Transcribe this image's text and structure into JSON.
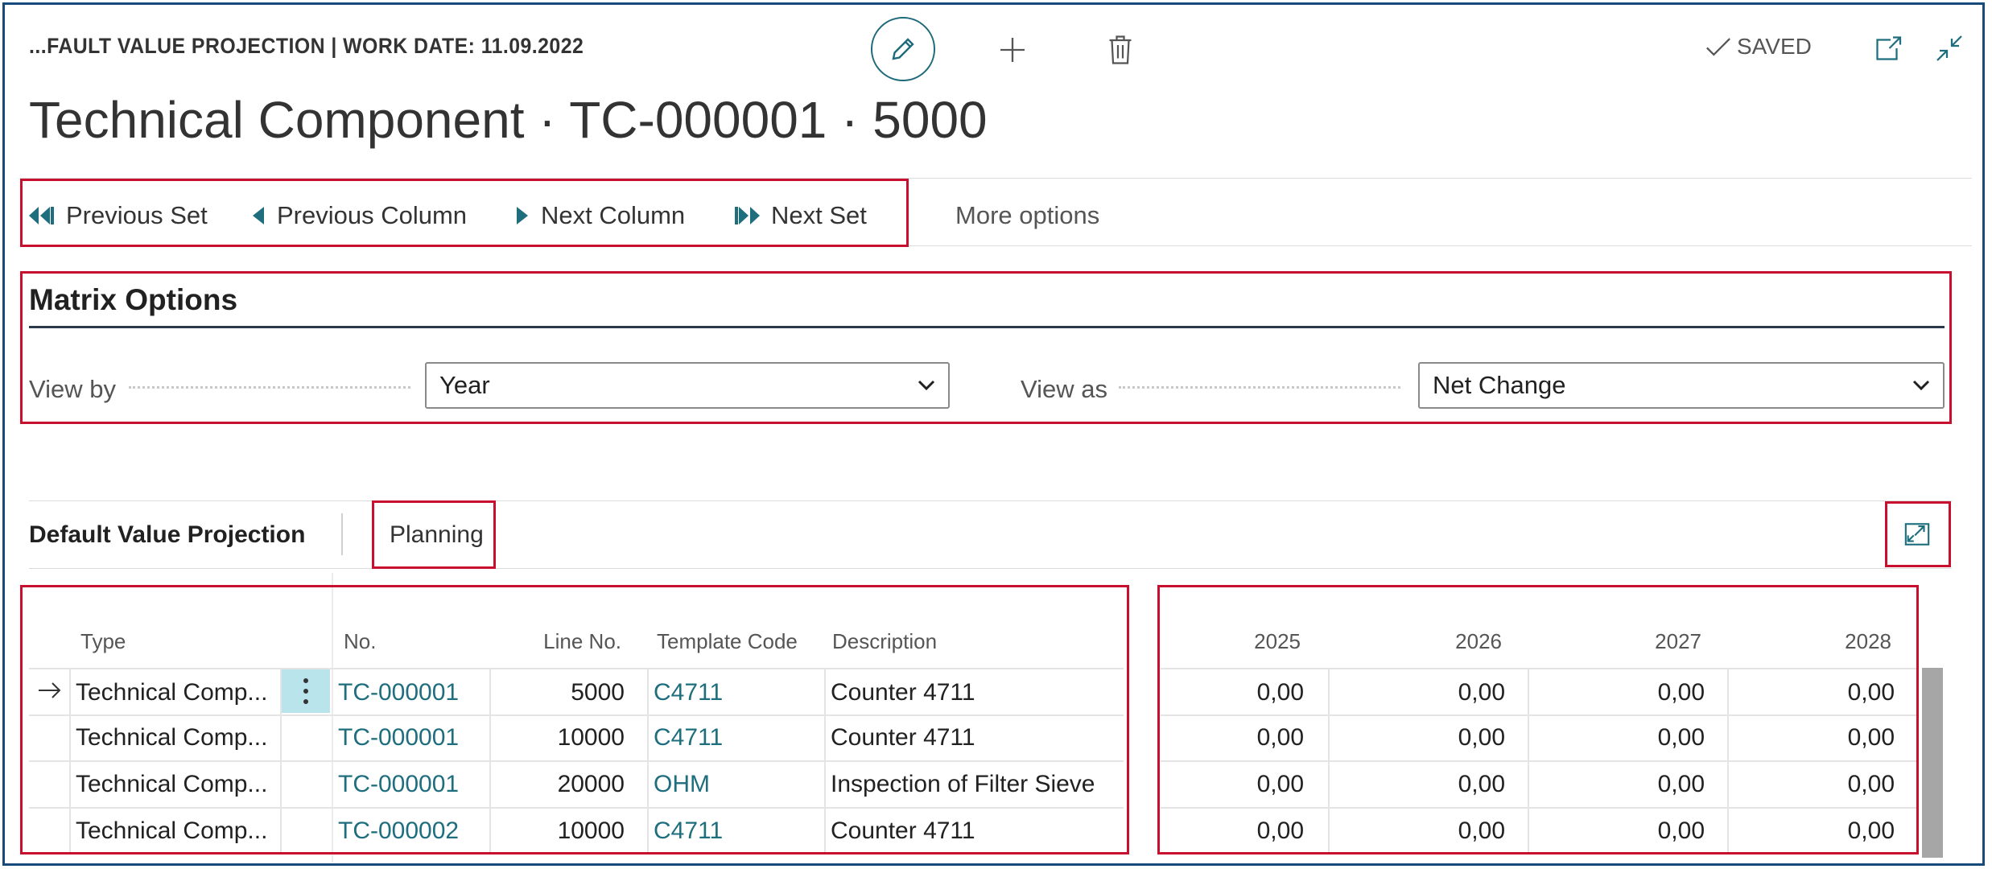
{
  "header": {
    "caption": "...FAULT VALUE PROJECTION | WORK DATE: 11.09.2022",
    "title": "Technical Component · TC-000001 · 5000",
    "saved_label": "SAVED"
  },
  "actions": {
    "previous_set": "Previous Set",
    "previous_column": "Previous Column",
    "next_column": "Next Column",
    "next_set": "Next Set",
    "more_options": "More options"
  },
  "matrix_options": {
    "title": "Matrix Options",
    "view_by_label": "View by",
    "view_by_value": "Year",
    "view_as_label": "View as",
    "view_as_value": "Net Change"
  },
  "part": {
    "title": "Default Value Projection",
    "tab": "Planning"
  },
  "table": {
    "headers": {
      "type": "Type",
      "no": "No.",
      "line_no": "Line No.",
      "template_code": "Template Code",
      "description": "Description"
    },
    "rows": [
      {
        "type": "Technical Comp...",
        "no": "TC-000001",
        "line_no": "5000",
        "template_code": "C4711",
        "description": "Counter 4711"
      },
      {
        "type": "Technical Comp...",
        "no": "TC-000001",
        "line_no": "10000",
        "template_code": "C4711",
        "description": "Counter 4711"
      },
      {
        "type": "Technical Comp...",
        "no": "TC-000001",
        "line_no": "20000",
        "template_code": "OHM",
        "description": "Inspection of Filter Sieve"
      },
      {
        "type": "Technical Comp...",
        "no": "TC-000002",
        "line_no": "10000",
        "template_code": "C4711",
        "description": "Counter 4711"
      }
    ]
  },
  "matrix": {
    "columns": [
      "2025",
      "2026",
      "2027",
      "2028"
    ],
    "rows": [
      [
        "0,00",
        "0,00",
        "0,00",
        "0,00"
      ],
      [
        "0,00",
        "0,00",
        "0,00",
        "0,00"
      ],
      [
        "0,00",
        "0,00",
        "0,00",
        "0,00"
      ],
      [
        "0,00",
        "0,00",
        "0,00",
        "0,00"
      ]
    ]
  },
  "colors": {
    "accent": "#1e6e7e",
    "highlight": "#c8102e",
    "frame": "#17497a"
  },
  "icons": [
    "edit-icon",
    "plus-icon",
    "trash-icon",
    "check-icon",
    "open-new-window-icon",
    "collapse-icon",
    "previous-set-icon",
    "previous-column-icon",
    "next-column-icon",
    "next-set-icon",
    "chevron-down-icon",
    "expand-icon",
    "row-arrow-icon",
    "row-menu-icon"
  ]
}
